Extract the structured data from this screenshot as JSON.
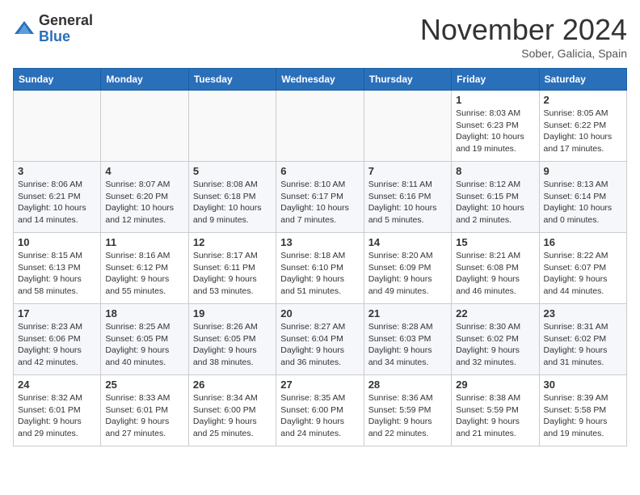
{
  "header": {
    "logo_general": "General",
    "logo_blue": "Blue",
    "month_title": "November 2024",
    "location": "Sober, Galicia, Spain"
  },
  "days_of_week": [
    "Sunday",
    "Monday",
    "Tuesday",
    "Wednesday",
    "Thursday",
    "Friday",
    "Saturday"
  ],
  "weeks": [
    [
      {
        "day": "",
        "info": ""
      },
      {
        "day": "",
        "info": ""
      },
      {
        "day": "",
        "info": ""
      },
      {
        "day": "",
        "info": ""
      },
      {
        "day": "",
        "info": ""
      },
      {
        "day": "1",
        "info": "Sunrise: 8:03 AM\nSunset: 6:23 PM\nDaylight: 10 hours\nand 19 minutes."
      },
      {
        "day": "2",
        "info": "Sunrise: 8:05 AM\nSunset: 6:22 PM\nDaylight: 10 hours\nand 17 minutes."
      }
    ],
    [
      {
        "day": "3",
        "info": "Sunrise: 8:06 AM\nSunset: 6:21 PM\nDaylight: 10 hours\nand 14 minutes."
      },
      {
        "day": "4",
        "info": "Sunrise: 8:07 AM\nSunset: 6:20 PM\nDaylight: 10 hours\nand 12 minutes."
      },
      {
        "day": "5",
        "info": "Sunrise: 8:08 AM\nSunset: 6:18 PM\nDaylight: 10 hours\nand 9 minutes."
      },
      {
        "day": "6",
        "info": "Sunrise: 8:10 AM\nSunset: 6:17 PM\nDaylight: 10 hours\nand 7 minutes."
      },
      {
        "day": "7",
        "info": "Sunrise: 8:11 AM\nSunset: 6:16 PM\nDaylight: 10 hours\nand 5 minutes."
      },
      {
        "day": "8",
        "info": "Sunrise: 8:12 AM\nSunset: 6:15 PM\nDaylight: 10 hours\nand 2 minutes."
      },
      {
        "day": "9",
        "info": "Sunrise: 8:13 AM\nSunset: 6:14 PM\nDaylight: 10 hours\nand 0 minutes."
      }
    ],
    [
      {
        "day": "10",
        "info": "Sunrise: 8:15 AM\nSunset: 6:13 PM\nDaylight: 9 hours\nand 58 minutes."
      },
      {
        "day": "11",
        "info": "Sunrise: 8:16 AM\nSunset: 6:12 PM\nDaylight: 9 hours\nand 55 minutes."
      },
      {
        "day": "12",
        "info": "Sunrise: 8:17 AM\nSunset: 6:11 PM\nDaylight: 9 hours\nand 53 minutes."
      },
      {
        "day": "13",
        "info": "Sunrise: 8:18 AM\nSunset: 6:10 PM\nDaylight: 9 hours\nand 51 minutes."
      },
      {
        "day": "14",
        "info": "Sunrise: 8:20 AM\nSunset: 6:09 PM\nDaylight: 9 hours\nand 49 minutes."
      },
      {
        "day": "15",
        "info": "Sunrise: 8:21 AM\nSunset: 6:08 PM\nDaylight: 9 hours\nand 46 minutes."
      },
      {
        "day": "16",
        "info": "Sunrise: 8:22 AM\nSunset: 6:07 PM\nDaylight: 9 hours\nand 44 minutes."
      }
    ],
    [
      {
        "day": "17",
        "info": "Sunrise: 8:23 AM\nSunset: 6:06 PM\nDaylight: 9 hours\nand 42 minutes."
      },
      {
        "day": "18",
        "info": "Sunrise: 8:25 AM\nSunset: 6:05 PM\nDaylight: 9 hours\nand 40 minutes."
      },
      {
        "day": "19",
        "info": "Sunrise: 8:26 AM\nSunset: 6:05 PM\nDaylight: 9 hours\nand 38 minutes."
      },
      {
        "day": "20",
        "info": "Sunrise: 8:27 AM\nSunset: 6:04 PM\nDaylight: 9 hours\nand 36 minutes."
      },
      {
        "day": "21",
        "info": "Sunrise: 8:28 AM\nSunset: 6:03 PM\nDaylight: 9 hours\nand 34 minutes."
      },
      {
        "day": "22",
        "info": "Sunrise: 8:30 AM\nSunset: 6:02 PM\nDaylight: 9 hours\nand 32 minutes."
      },
      {
        "day": "23",
        "info": "Sunrise: 8:31 AM\nSunset: 6:02 PM\nDaylight: 9 hours\nand 31 minutes."
      }
    ],
    [
      {
        "day": "24",
        "info": "Sunrise: 8:32 AM\nSunset: 6:01 PM\nDaylight: 9 hours\nand 29 minutes."
      },
      {
        "day": "25",
        "info": "Sunrise: 8:33 AM\nSunset: 6:01 PM\nDaylight: 9 hours\nand 27 minutes."
      },
      {
        "day": "26",
        "info": "Sunrise: 8:34 AM\nSunset: 6:00 PM\nDaylight: 9 hours\nand 25 minutes."
      },
      {
        "day": "27",
        "info": "Sunrise: 8:35 AM\nSunset: 6:00 PM\nDaylight: 9 hours\nand 24 minutes."
      },
      {
        "day": "28",
        "info": "Sunrise: 8:36 AM\nSunset: 5:59 PM\nDaylight: 9 hours\nand 22 minutes."
      },
      {
        "day": "29",
        "info": "Sunrise: 8:38 AM\nSunset: 5:59 PM\nDaylight: 9 hours\nand 21 minutes."
      },
      {
        "day": "30",
        "info": "Sunrise: 8:39 AM\nSunset: 5:58 PM\nDaylight: 9 hours\nand 19 minutes."
      }
    ]
  ]
}
